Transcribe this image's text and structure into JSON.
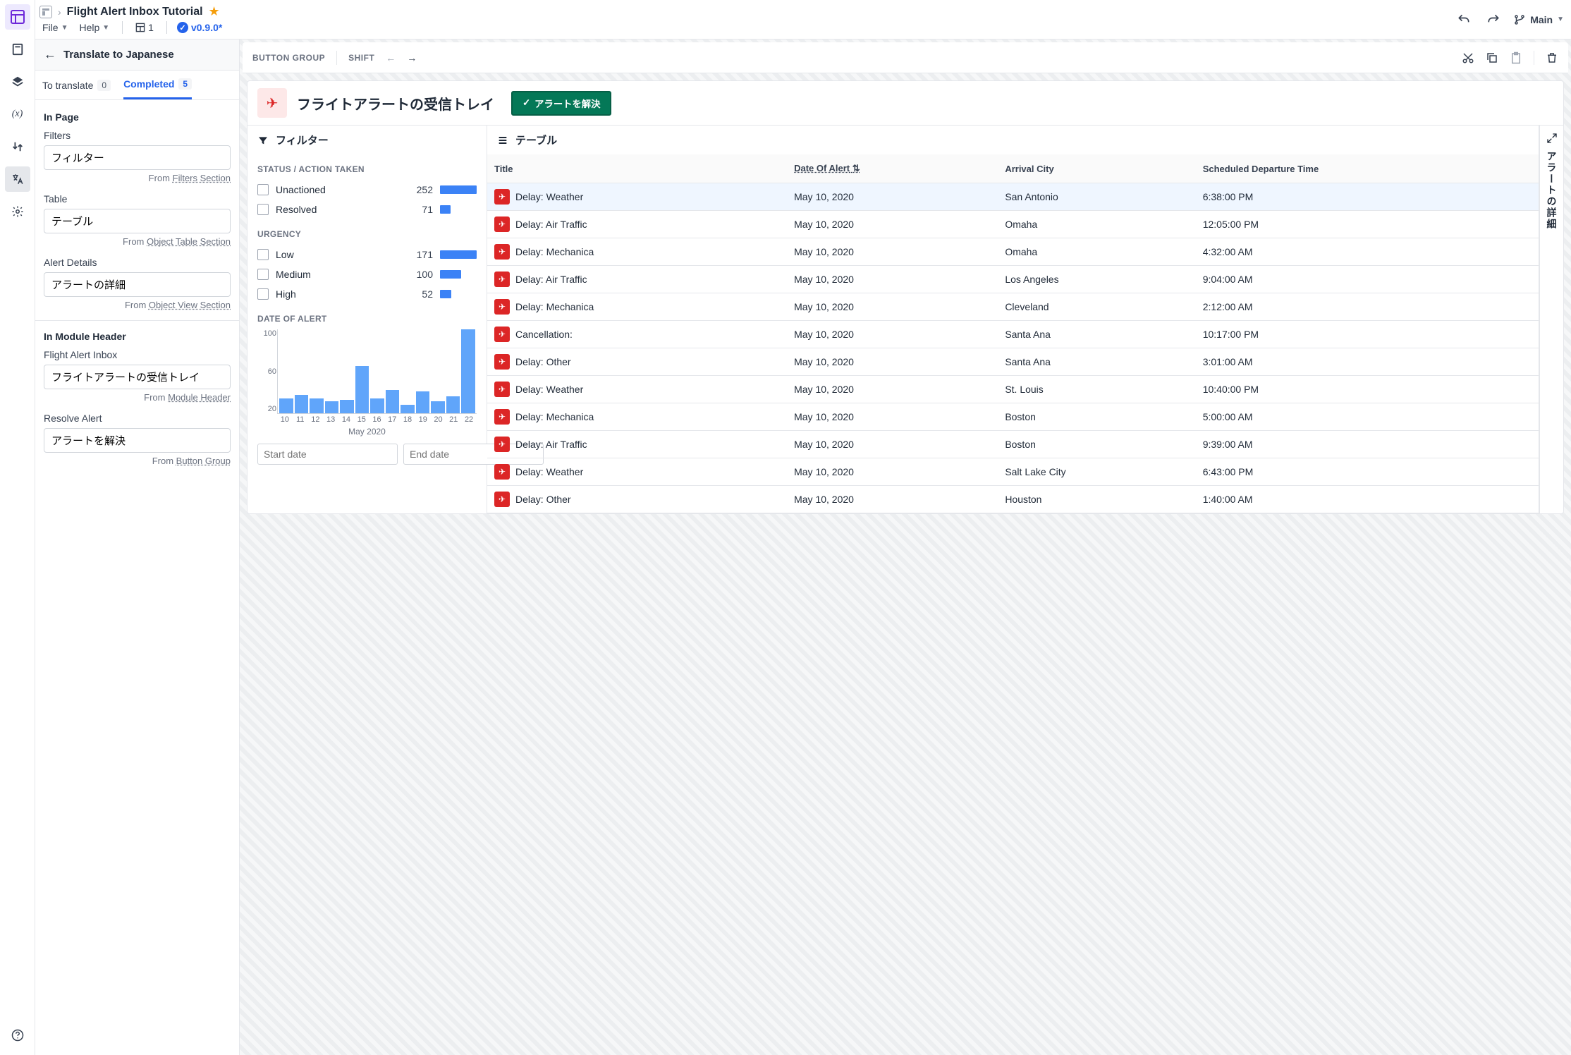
{
  "breadcrumb": {
    "title": "Flight Alert Inbox Tutorial"
  },
  "menus": {
    "file": "File",
    "help": "Help",
    "layout_count": "1"
  },
  "version": "v0.9.0*",
  "branch": "Main",
  "sidepanel": {
    "title": "Translate to Japanese",
    "tabs": {
      "to_translate": {
        "label": "To translate",
        "count": "0"
      },
      "completed": {
        "label": "Completed",
        "count": "5"
      }
    },
    "in_page_title": "In Page",
    "fields": [
      {
        "label": "Filters",
        "value": "フィルター",
        "from_prefix": "From ",
        "from_link": "Filters Section"
      },
      {
        "label": "Table",
        "value": "テーブル",
        "from_prefix": "From ",
        "from_link": "Object Table Section"
      },
      {
        "label": "Alert Details",
        "value": "アラートの詳細",
        "from_prefix": "From ",
        "from_link": "Object View Section"
      }
    ],
    "in_module_title": "In Module Header",
    "module_fields": [
      {
        "label": "Flight Alert Inbox",
        "value": "フライトアラートの受信トレイ",
        "from_prefix": "From ",
        "from_link": "Module Header"
      },
      {
        "label": "Resolve Alert",
        "value": "アラートを解決",
        "from_prefix": "From ",
        "from_link": "Button Group"
      }
    ]
  },
  "canvas_toolbar": {
    "group": "BUTTON GROUP",
    "shift": "SHIFT"
  },
  "page_header": {
    "title": "フライトアラートの受信トレイ",
    "resolve_btn": "アラートを解決"
  },
  "filters_panel": {
    "title": "フィルター",
    "status_title": "STATUS / ACTION TAKEN",
    "status_items": [
      {
        "label": "Unactioned",
        "count": "252",
        "bar": 100
      },
      {
        "label": "Resolved",
        "count": "71",
        "bar": 28
      }
    ],
    "urgency_title": "URGENCY",
    "urgency_items": [
      {
        "label": "Low",
        "count": "171",
        "bar": 100
      },
      {
        "label": "Medium",
        "count": "100",
        "bar": 58
      },
      {
        "label": "High",
        "count": "52",
        "bar": 30
      }
    ],
    "date_title": "DATE OF ALERT",
    "start_placeholder": "Start date",
    "end_placeholder": "End date"
  },
  "chart_data": {
    "type": "bar",
    "categories": [
      "10",
      "11",
      "12",
      "13",
      "14",
      "15",
      "16",
      "17",
      "18",
      "19",
      "20",
      "21",
      "22"
    ],
    "values": [
      18,
      22,
      18,
      14,
      16,
      56,
      18,
      28,
      10,
      26,
      14,
      20,
      100
    ],
    "ylabel": "",
    "xlabel": "May 2020",
    "yticks": [
      "100",
      "60",
      "20"
    ],
    "ylim": [
      0,
      100
    ]
  },
  "table_panel": {
    "title": "テーブル",
    "cols": {
      "title": "Title",
      "date": "Date Of Alert",
      "city": "Arrival City",
      "dep": "Scheduled Departure Time"
    },
    "rows": [
      {
        "title": "Delay: Weather",
        "date": "May 10, 2020",
        "city": "San Antonio",
        "dep": "6:38:00 PM"
      },
      {
        "title": "Delay: Air Traffic",
        "date": "May 10, 2020",
        "city": "Omaha",
        "dep": "12:05:00 PM"
      },
      {
        "title": "Delay: Mechanica",
        "date": "May 10, 2020",
        "city": "Omaha",
        "dep": "4:32:00 AM"
      },
      {
        "title": "Delay: Air Traffic",
        "date": "May 10, 2020",
        "city": "Los Angeles",
        "dep": "9:04:00 AM"
      },
      {
        "title": "Delay: Mechanica",
        "date": "May 10, 2020",
        "city": "Cleveland",
        "dep": "2:12:00 AM"
      },
      {
        "title": "Cancellation:",
        "date": "May 10, 2020",
        "city": "Santa Ana",
        "dep": "10:17:00 PM"
      },
      {
        "title": "Delay: Other",
        "date": "May 10, 2020",
        "city": "Santa Ana",
        "dep": "3:01:00 AM"
      },
      {
        "title": "Delay: Weather",
        "date": "May 10, 2020",
        "city": "St. Louis",
        "dep": "10:40:00 PM"
      },
      {
        "title": "Delay: Mechanica",
        "date": "May 10, 2020",
        "city": "Boston",
        "dep": "5:00:00 AM"
      },
      {
        "title": "Delay: Air Traffic",
        "date": "May 10, 2020",
        "city": "Boston",
        "dep": "9:39:00 AM"
      },
      {
        "title": "Delay: Weather",
        "date": "May 10, 2020",
        "city": "Salt Lake City",
        "dep": "6:43:00 PM"
      },
      {
        "title": "Delay: Other",
        "date": "May 10, 2020",
        "city": "Houston",
        "dep": "1:40:00 AM"
      }
    ]
  },
  "detail_rail": {
    "title": "アラートの詳細"
  }
}
